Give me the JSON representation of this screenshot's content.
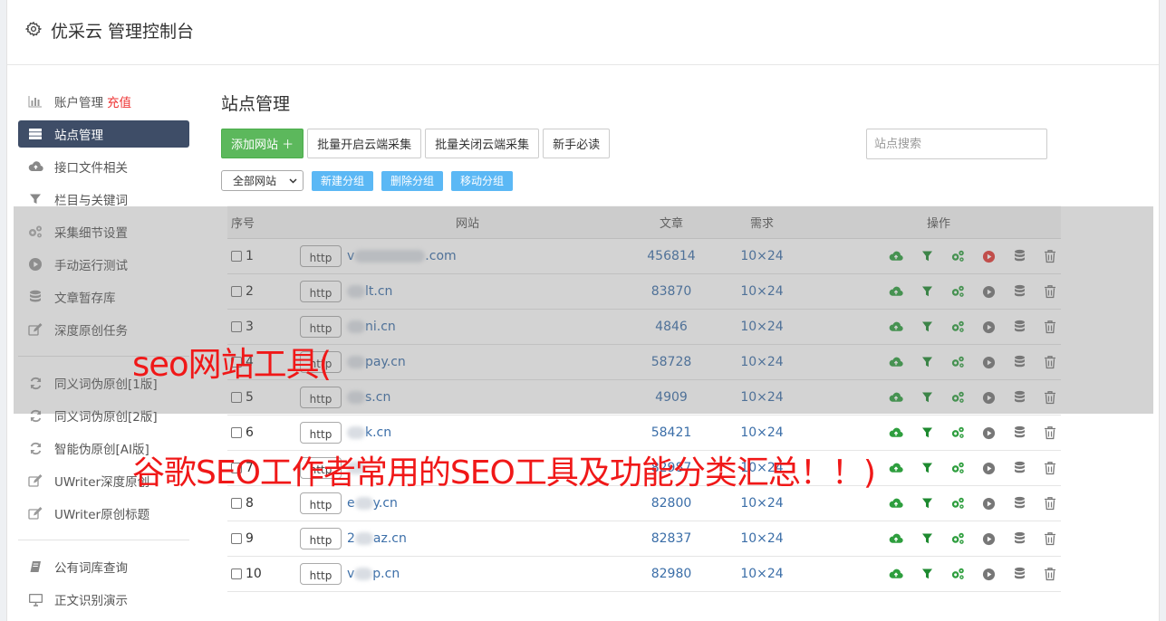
{
  "app": {
    "title": "优采云 管理控制台"
  },
  "sidebar": {
    "groups": [
      [
        {
          "label": "账户管理",
          "badge": "充值",
          "icon": "bar-chart-icon"
        },
        {
          "label": "站点管理",
          "icon": "server-icon",
          "active": true
        },
        {
          "label": "接口文件相关",
          "icon": "cloud-upload-icon"
        },
        {
          "label": "栏目与关键词",
          "icon": "filter-icon"
        },
        {
          "label": "采集细节设置",
          "icon": "cogs-icon"
        },
        {
          "label": "手动运行测试",
          "icon": "play-icon"
        },
        {
          "label": "文章暂存库",
          "icon": "database-icon"
        },
        {
          "label": "深度原创任务",
          "icon": "edit-icon"
        }
      ],
      [
        {
          "label": "同义词伪原创[1版]",
          "icon": "refresh-icon"
        },
        {
          "label": "同义词伪原创[2版]",
          "icon": "refresh-icon"
        },
        {
          "label": "智能伪原创[AI版]",
          "icon": "refresh-icon"
        },
        {
          "label": "UWriter深度原创",
          "icon": "edit-icon"
        },
        {
          "label": "UWriter原创标题",
          "icon": "edit-icon"
        }
      ],
      [
        {
          "label": "公有词库查询",
          "icon": "book-icon"
        },
        {
          "label": "正文识别演示",
          "icon": "monitor-icon"
        }
      ]
    ]
  },
  "main": {
    "title": "站点管理",
    "toolbar": {
      "add": "添加网站 ＋",
      "batch_on": "批量开启云端采集",
      "batch_off": "批量关闭云端采集",
      "guide": "新手必读"
    },
    "search_placeholder": "站点搜索",
    "group_select": "全部网站",
    "group_buttons": [
      "新建分组",
      "删除分组",
      "移动分组"
    ],
    "columns": [
      "序号",
      "网站",
      "文章",
      "需求",
      "操作"
    ],
    "rows": [
      {
        "no": "1",
        "domain_start": "v",
        "domain_end": ".com",
        "articles": "456814",
        "need": "10×24",
        "active": true
      },
      {
        "no": "2",
        "domain_start": "",
        "domain_end": "lt.cn",
        "articles": "83870",
        "need": "10×24",
        "active": false
      },
      {
        "no": "3",
        "domain_start": "",
        "domain_end": "ni.cn",
        "articles": "4846",
        "need": "10×24",
        "active": false
      },
      {
        "no": "4",
        "domain_start": "",
        "domain_end": "pay.cn",
        "articles": "58728",
        "need": "10×24",
        "active": false
      },
      {
        "no": "5",
        "domain_start": "",
        "domain_end": "s.cn",
        "articles": "4909",
        "need": "10×24",
        "active": false
      },
      {
        "no": "6",
        "domain_start": "",
        "domain_end": "k.cn",
        "articles": "58421",
        "need": "10×24",
        "active": false
      },
      {
        "no": "7",
        "domain_start": "",
        "domain_end": "",
        "articles": "82987",
        "need": "10×24",
        "active": false
      },
      {
        "no": "8",
        "domain_start": "e",
        "domain_end": "y.cn",
        "articles": "82800",
        "need": "10×24",
        "active": false
      },
      {
        "no": "9",
        "domain_start": "2",
        "domain_end": "az.cn",
        "articles": "82837",
        "need": "10×24",
        "active": false
      },
      {
        "no": "10",
        "domain_start": "v",
        "domain_end": "p.cn",
        "articles": "82980",
        "need": "10×24",
        "active": false
      }
    ],
    "http_label": "http"
  },
  "watermark": {
    "line1": "seo网站工具(",
    "line2": "谷歌SEO工作者常用的SEO工具及功能分类汇总！！)"
  },
  "colors": {
    "accent": "#3e4d67",
    "green": "#5cb85c",
    "link": "#3b6ea8",
    "watermark": "#f01818",
    "run": "#e53935"
  }
}
